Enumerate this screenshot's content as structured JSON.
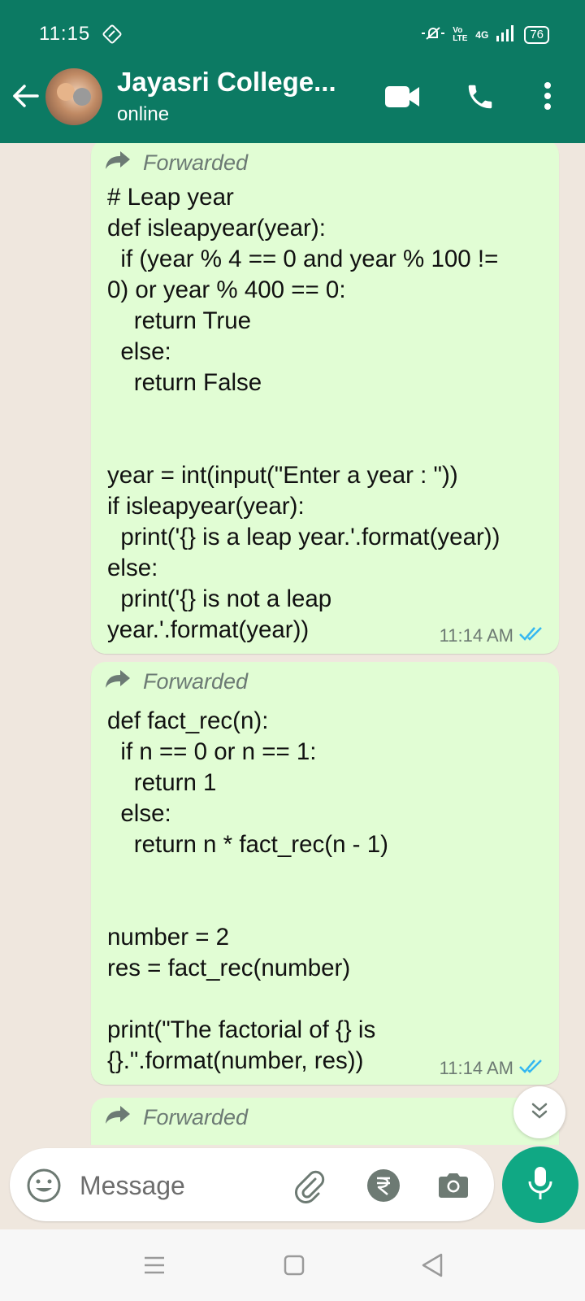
{
  "status_bar": {
    "time": "11:15",
    "network_label": "4G",
    "volte_label": "Vo LTE",
    "battery": "76"
  },
  "header": {
    "title": "Jayasri College...",
    "status": "online"
  },
  "messages": [
    {
      "forwarded_label": "Forwarded",
      "text": "# Leap year\ndef isleapyear(year):\n  if (year % 4 == 0 and year % 100 !=\n0) or year % 400 == 0:\n    return True\n  else:\n    return False\n\n\nyear = int(input(\"Enter a year : \"))\nif isleapyear(year):\n  print('{} is a leap year.'.format(year))\nelse:\n  print('{} is not a leap\nyear.'.format(year))",
      "time": "11:14 AM"
    },
    {
      "forwarded_label": "Forwarded",
      "text": "def fact_rec(n):\n  if n == 0 or n == 1:\n    return 1\n  else:\n    return n * fact_rec(n - 1)\n\n\nnumber = 2\nres = fact_rec(number)\n\nprint(\"The factorial of {} is\n{}.\".format(number, res))",
      "time": "11:14 AM"
    },
    {
      "forwarded_label": "Forwarded"
    }
  ],
  "input": {
    "placeholder": "Message"
  },
  "icons": {
    "back": "arrow-left-icon",
    "video": "video-call-icon",
    "call": "phone-icon",
    "menu": "more-vertical-icon",
    "forward": "forward-icon",
    "read": "double-check-icon",
    "emoji": "emoji-icon",
    "attach": "paperclip-icon",
    "payment": "rupee-icon",
    "camera": "camera-icon",
    "mic": "mic-icon",
    "scroll": "chevron-double-down-icon"
  },
  "colors": {
    "header": "#0c7a63",
    "bubble": "#e1fdd4",
    "chat_bg": "#efe7de",
    "read_tick": "#34b7f1",
    "mic_button": "#10a884"
  }
}
